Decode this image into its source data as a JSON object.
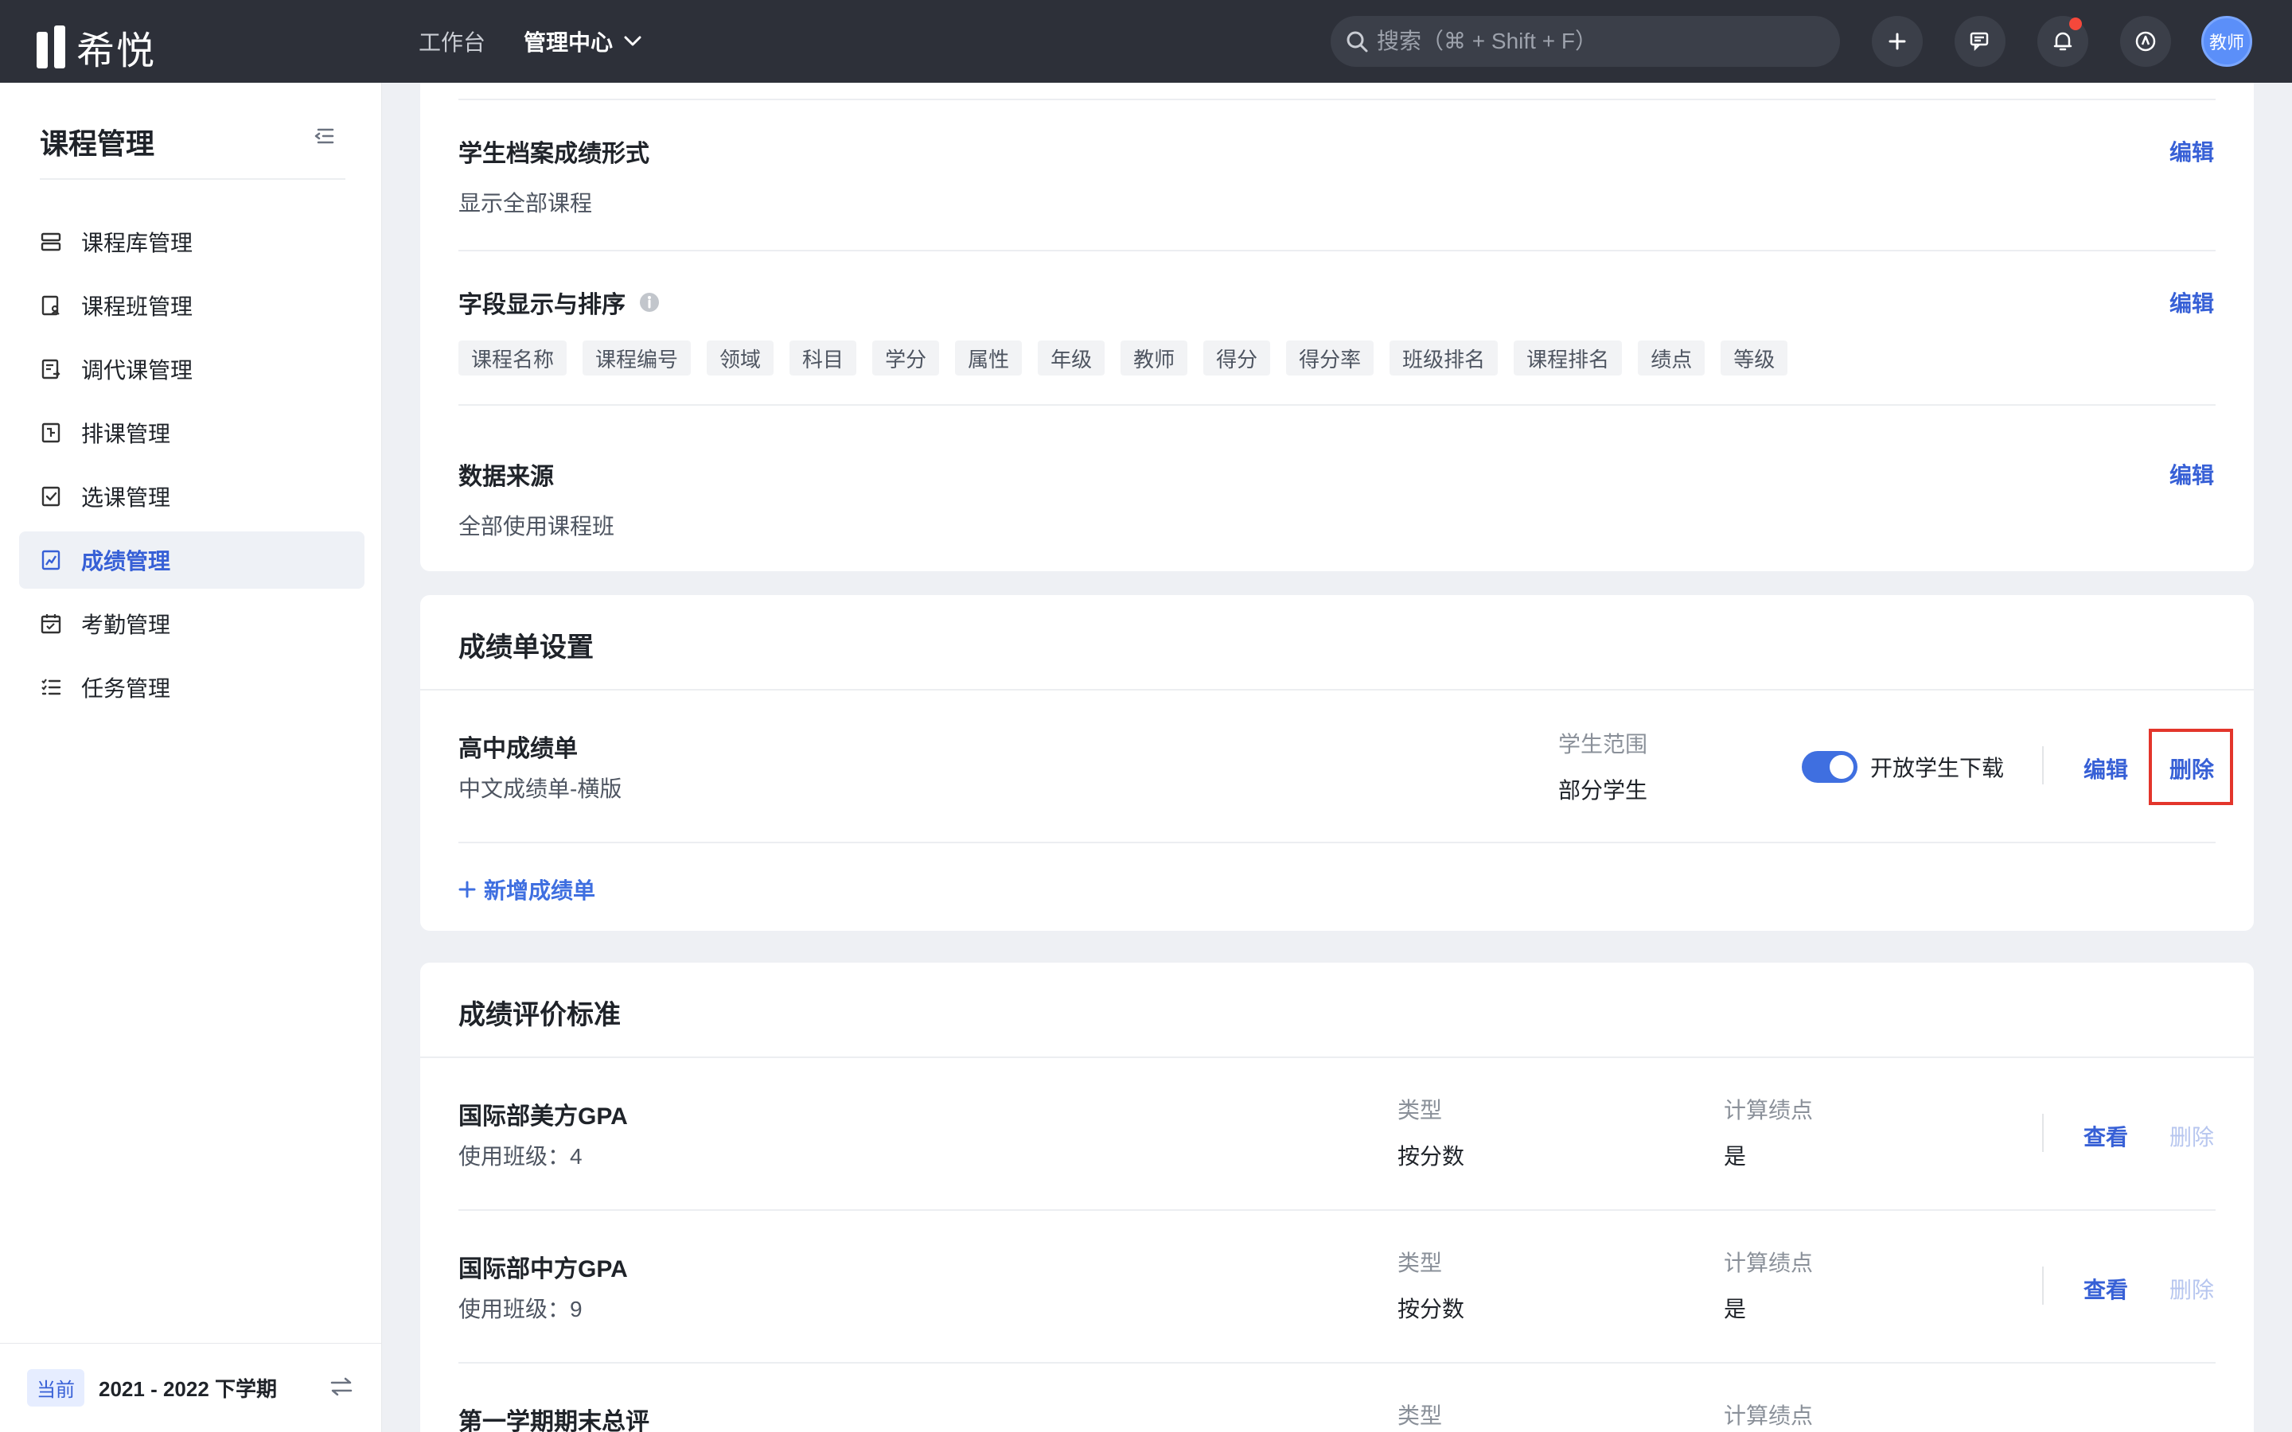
{
  "topbar": {
    "logo_text": "希悦",
    "nav": [
      "工作台",
      "管理中心"
    ],
    "search_placeholder": "搜索（⌘ + Shift + F）",
    "avatar_label": "教师"
  },
  "sidebar": {
    "title": "课程管理",
    "items": [
      {
        "label": "课程库管理",
        "icon": "course-library-icon"
      },
      {
        "label": "课程班管理",
        "icon": "course-class-icon"
      },
      {
        "label": "调代课管理",
        "icon": "substitute-icon"
      },
      {
        "label": "排课管理",
        "icon": "schedule-icon"
      },
      {
        "label": "选课管理",
        "icon": "selection-icon"
      },
      {
        "label": "成绩管理",
        "icon": "grade-icon"
      },
      {
        "label": "考勤管理",
        "icon": "attendance-icon"
      },
      {
        "label": "任务管理",
        "icon": "task-icon"
      }
    ],
    "active_index": 5,
    "term_tag": "当前",
    "term_text": "2021 - 2022 下学期"
  },
  "archive": {
    "section1_title": "学生档案成绩形式",
    "section1_value": "显示全部课程",
    "section2_title": "字段显示与排序",
    "fields": [
      "课程名称",
      "课程编号",
      "领域",
      "科目",
      "学分",
      "属性",
      "年级",
      "教师",
      "得分",
      "得分率",
      "班级排名",
      "课程排名",
      "绩点",
      "等级"
    ],
    "section3_title": "数据来源",
    "section3_value": "全部使用课程班",
    "edit_label": "编辑"
  },
  "report_settings": {
    "title": "成绩单设置",
    "item_name": "高中成绩单",
    "item_sub": "中文成绩单-横版",
    "scope_label": "学生范围",
    "scope_value": "部分学生",
    "toggle_label": "开放学生下载",
    "toggle_on": true,
    "edit_label": "编辑",
    "delete_label": "删除",
    "add_label": "新增成绩单"
  },
  "standards": {
    "title": "成绩评价标准",
    "type_label": "类型",
    "gpa_label": "计算绩点",
    "view_label": "查看",
    "delete_label": "删除",
    "rows": [
      {
        "name": "国际部美方GPA",
        "sub": "使用班级：4",
        "type": "按分数",
        "gpa": "是"
      },
      {
        "name": "国际部中方GPA",
        "sub": "使用班级：9",
        "type": "按分数",
        "gpa": "是"
      },
      {
        "name": "第一学期期末总评",
        "sub": "",
        "type": "",
        "gpa": ""
      }
    ]
  },
  "colors": {
    "accent": "#3760d6",
    "topbar": "#2d3039",
    "highlight": "#e3352b"
  }
}
